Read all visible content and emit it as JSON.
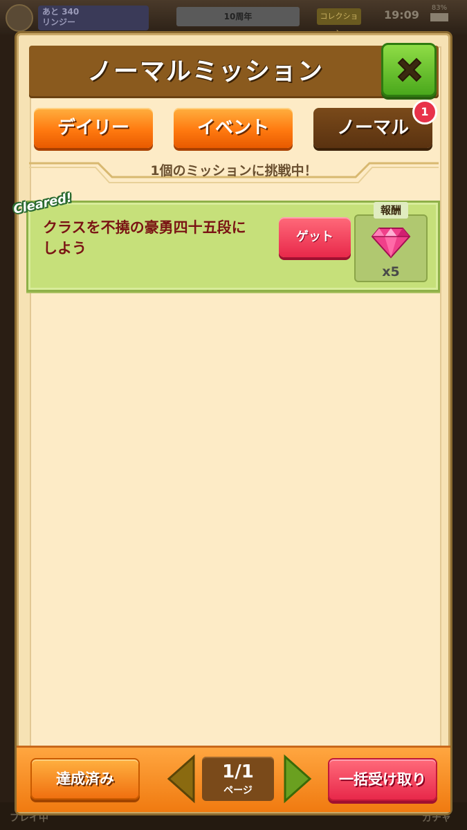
{
  "background": {
    "status_line1": "あと",
    "status_points": "340",
    "status_line2": "リンジー",
    "banner": "10周年",
    "chip": "コレクション",
    "time": "19:09",
    "battery": "83%",
    "bottom_left": "プレイ中",
    "bottom_right": "ガチャ"
  },
  "dialog": {
    "title": "ノーマルミッション"
  },
  "tabs": [
    {
      "label": "デイリー",
      "active": false
    },
    {
      "label": "イベント",
      "active": false
    },
    {
      "label": "ノーマル",
      "active": true
    }
  ],
  "tab_badge": "1",
  "ribbon": "1個のミッションに挑戦中！",
  "missions": [
    {
      "status": "Cleared!",
      "text_line1": "クラスを不撓の豪勇四十五段に",
      "text_line2": "しよう",
      "action_label": "ゲット",
      "reward_label": "報酬",
      "reward_icon": "pink-gem-icon",
      "reward_count": "x5"
    }
  ],
  "footer": {
    "done_label": "達成済み",
    "page": "1/1",
    "page_unit": "ページ",
    "bulk_label": "一括受け取り"
  },
  "colors": {
    "panel": "#fdebc6",
    "title_bar": "#8a5a1e",
    "tab_orange": "#ff7a10",
    "tab_active": "#5a3210",
    "card_green": "#c6e07a",
    "get_pink": "#e8284a",
    "close_green": "#4aa81c"
  }
}
